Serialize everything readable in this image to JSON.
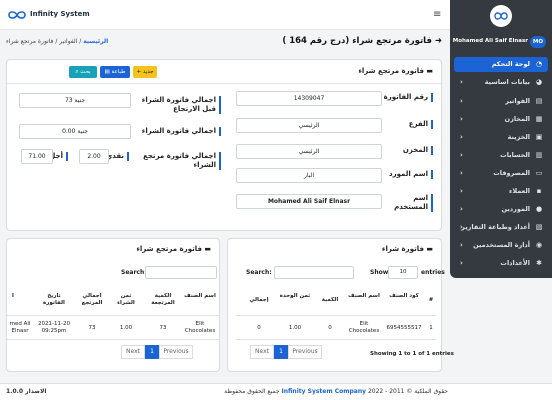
{
  "app": {
    "logo_text": "Infinity System"
  },
  "breadcrumb": {
    "home": "الرئيسية",
    "sep1": " / ",
    "invoices": "الفواتير",
    "sep2": " / ",
    "current": "فاتورة مرتجع شراء"
  },
  "page_title": "فاتورة مرتجع شراء (درج رقم 164 )",
  "main_card": {
    "title": "فاتورة مرتجع شراء",
    "buttons": {
      "add": "+ جديد",
      "print": "طباعة",
      "search": "بحث"
    },
    "fields": {
      "invoice_no_label": "رقم الفاتورة",
      "invoice_no": "14309047",
      "branch_label": "الفرع",
      "branch": "الرئيسي",
      "store_label": "المخزن",
      "store": "الرئيسي",
      "supplier_label": "اسم المورد",
      "supplier": "البار",
      "user_label": "اسم المستخدم",
      "user": "Mohamed Ali Saif Elnasr",
      "total_before_label": "اجمالي فاتورة الشراء قبل الارتجاع",
      "total_before": "73 جنية",
      "total_label": "اجمالي فاتورة الشراء",
      "total": "0.00 جنية",
      "return_total_label": "اجمالي فاتورة مرتجع الشراء",
      "cash_label": "نقدي",
      "cash": "2.00",
      "deferred_label": "أجل",
      "deferred": "71.00"
    }
  },
  "table_right": {
    "title": "فاتورة شراء",
    "show_label": "Show",
    "show_value": "10",
    "entries_label": "entries",
    "search_label": "Search:",
    "headers": [
      "#",
      "كود الصنف",
      "اسم الصنف",
      "الكمية",
      "ثمن الوحدة",
      "إجمالي"
    ],
    "row": [
      "1",
      "6954555517",
      "Elit Chocolates",
      "0",
      "1.00",
      "0"
    ],
    "info": "Showing 1 to 1 of 1 entries",
    "pager": {
      "prev": "Previous",
      "page": "1",
      "next": "Next"
    }
  },
  "table_left": {
    "title": "فاتورة مرتجع شراء",
    "search_label": "Search:",
    "headers": [
      "اسم الصنف",
      "الكمية المرتجعة",
      "ثمن الشراء",
      "اجمالي المرتجع",
      "تاريخ الفاتورة",
      "ا"
    ],
    "row": [
      "Elit Chocolates",
      "73",
      "1.00",
      "73",
      "2021-11-20 09:25pm",
      "med Ali Elnasr"
    ],
    "pager": {
      "prev": "Previous",
      "page": "1",
      "next": "Next"
    }
  },
  "sidebar": {
    "user_name": "Mohamed Ali Saif Elnasr",
    "user_initials": "MO",
    "items": [
      {
        "label": "لوحة التحكم",
        "icon": "dashboard-icon"
      },
      {
        "label": "بيانات اساسية",
        "icon": "pie-chart-icon"
      },
      {
        "label": "الفواتير",
        "icon": "invoice-icon"
      },
      {
        "label": "المخازن",
        "icon": "warehouse-icon"
      },
      {
        "label": "الخزينة",
        "icon": "safe-icon"
      },
      {
        "label": "الحسابات",
        "icon": "accounts-icon"
      },
      {
        "label": "المصروفات",
        "icon": "expenses-icon"
      },
      {
        "label": "العملاء",
        "icon": "customers-icon"
      },
      {
        "label": "الموردين",
        "icon": "suppliers-icon"
      },
      {
        "label": "أعداد وطباعة التقارير",
        "icon": "reports-icon"
      },
      {
        "label": "أدارة المستخدمين",
        "icon": "users-icon"
      },
      {
        "label": "الأعدادات",
        "icon": "settings-icon"
      }
    ]
  },
  "footer": {
    "version": "الاصدار 1.0.0",
    "copy_prefix": "حقوق الملكية © 2011 - 2022",
    "brand": "Infinity System Company",
    "copy_suffix": "جميع الحقوق محفوظة"
  },
  "colors": {
    "primary": "#1c64d6",
    "sidebar": "#343a40",
    "info": "#17a2b8",
    "warning": "#f6c21c"
  }
}
